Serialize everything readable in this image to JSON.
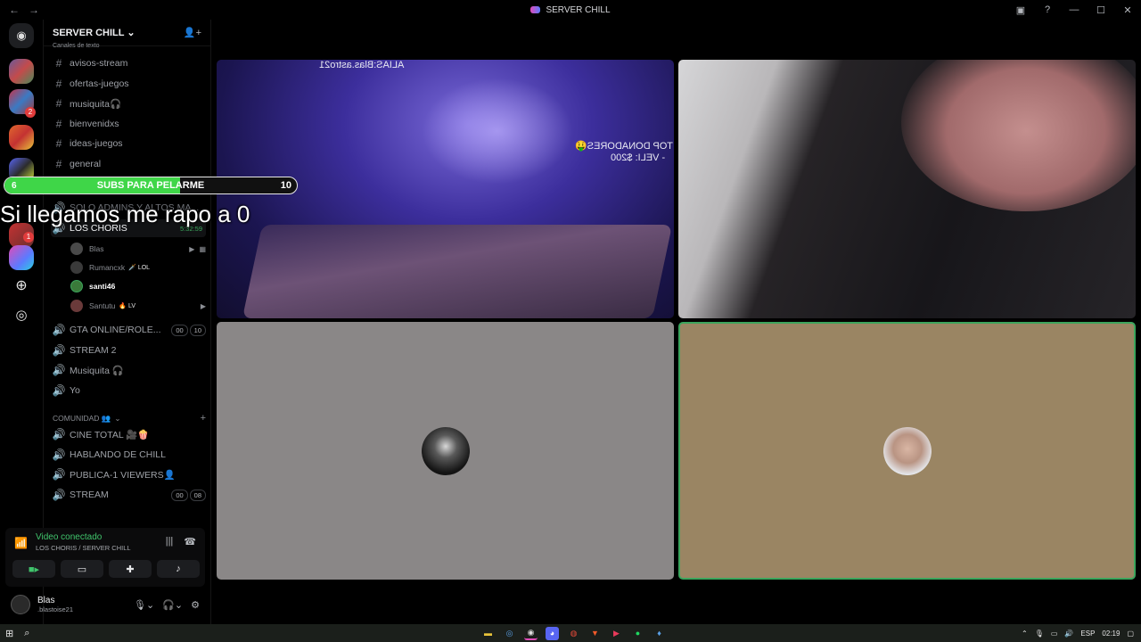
{
  "window": {
    "title": "SERVER CHILL"
  },
  "server": {
    "name": "SERVER CHILL",
    "text_section_label": "Canales de texto"
  },
  "text_channels": [
    "avisos-stream",
    "ofertas-juegos",
    "musiquita🎧",
    "bienvenidxs",
    "ideas-juegos",
    "general"
  ],
  "hidden_channel": "SOLO ADMINS Y ALTOS MA...",
  "active_voice": {
    "name": "LOS CHORIS",
    "time": "5:32:59"
  },
  "members": [
    {
      "name": "Blas",
      "tag": "",
      "color": "#8b8e94"
    },
    {
      "name": "Rumancxk",
      "tag": "🗡️ LOL",
      "color": "#8b8e94"
    },
    {
      "name": "santi46",
      "tag": "",
      "color": "#ffffff"
    },
    {
      "name": "Santutu",
      "tag": "🔥 LV",
      "color": "#8b8e94"
    }
  ],
  "voice_channels": [
    {
      "name": "GTA ONLINE/ROLE...",
      "pill1": "00",
      "pill2": "10"
    },
    {
      "name": "STREAM 2"
    },
    {
      "name": "Musiquita 🎧"
    },
    {
      "name": "Yo"
    }
  ],
  "community": {
    "label": "COMUNIDAD 👥",
    "channels": [
      {
        "name": "CINE TOTAL 🎥🍿"
      },
      {
        "name": "HABLANDO DE CHILL"
      },
      {
        "name": "PUBLICA-1 VIEWERS👤"
      },
      {
        "name": "STREAM",
        "pill1": "00",
        "pill2": "08"
      }
    ]
  },
  "voice_panel": {
    "status": "Video conectado",
    "location": "LOS CHORIS / SERVER CHILL"
  },
  "user": {
    "display": "Blas",
    "username": ".blastoise21"
  },
  "stream_overlay": {
    "alias": "ALIAS:Blas.astro21",
    "donors_title": "TOP DONADORES🤑",
    "donors_line": "- VELI: $200",
    "subs_goal": {
      "label": "SUBS PARA PELARME",
      "current": "6",
      "target": "10",
      "progress": 0.6
    },
    "caption": "Si llegamos me rapo a 0"
  },
  "taskbar": {
    "lang": "ESP",
    "time": "02:19"
  }
}
